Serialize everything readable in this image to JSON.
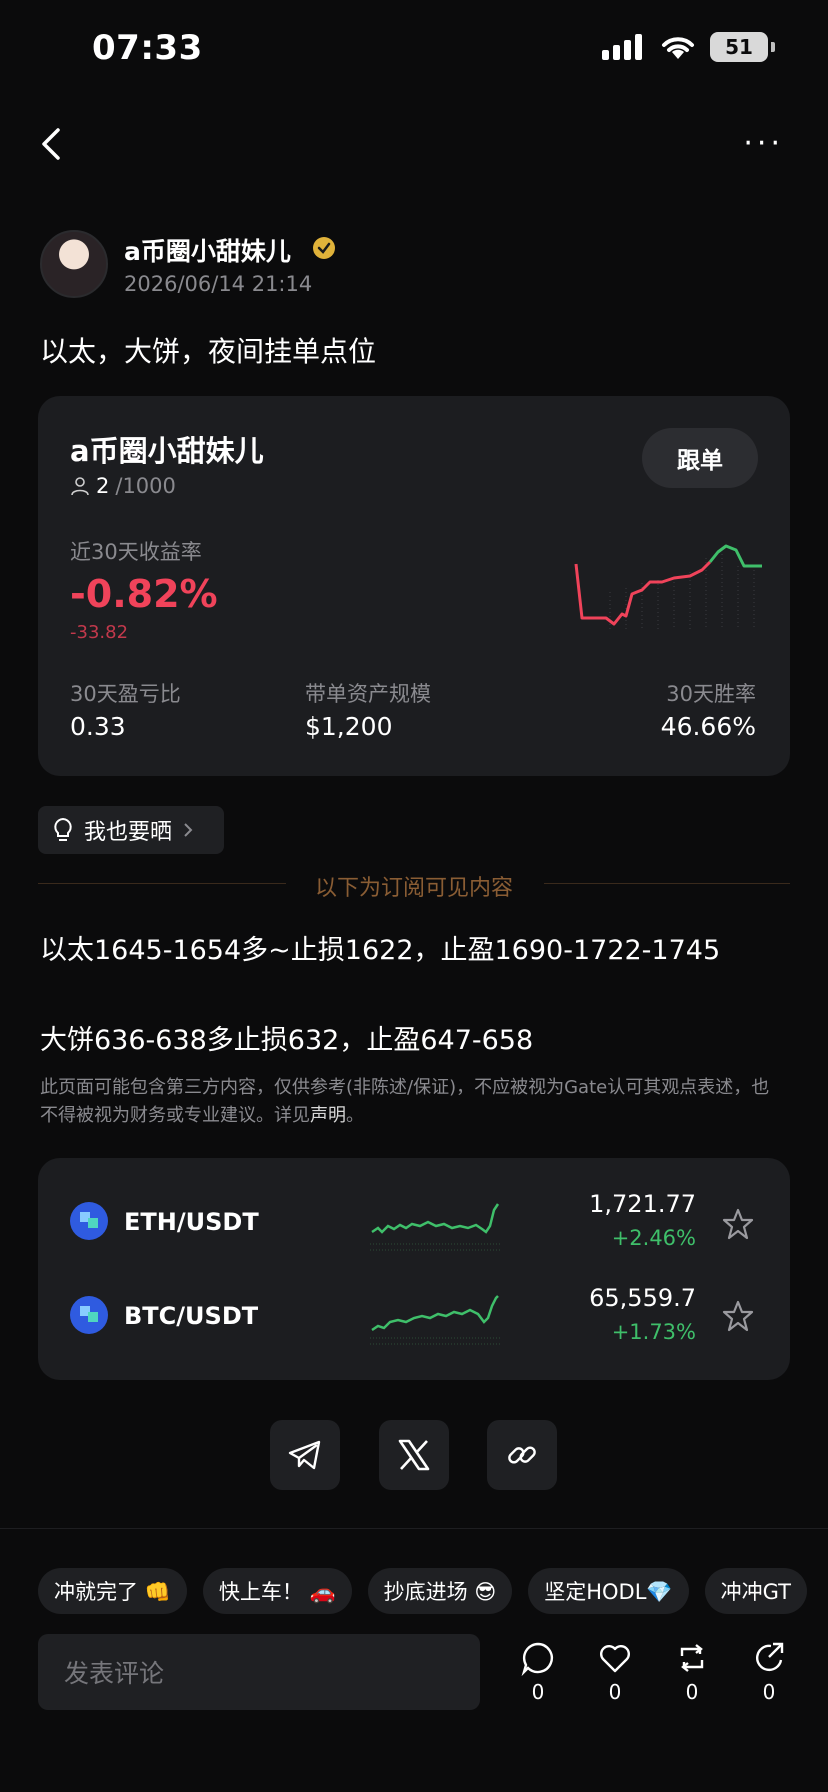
{
  "status_bar": {
    "time": "07:33",
    "battery": "51"
  },
  "post": {
    "author": "a币圈小甜妹儿",
    "time": "2026/06/14 21:14",
    "title": "以太，大饼，夜间挂单点位"
  },
  "trader_card": {
    "name": "a币圈小甜妹儿",
    "followers_current": "2",
    "followers_max": "/1000",
    "follow_label": "跟单",
    "roi_label": "近30天收益率",
    "roi_value": "-0.82%",
    "roi_abs": "-33.82",
    "stats": [
      {
        "label": "30天盈亏比",
        "value": "0.33"
      },
      {
        "label": "带单资产规模",
        "value": "$1,200"
      },
      {
        "label": "30天胜率",
        "value": "46.66%"
      }
    ],
    "colors": {
      "negative": "#f0435a",
      "positive": "#3fbf6a"
    }
  },
  "share_badge": "我也要晒",
  "subscriber_divider": "以下为订阅可见内容",
  "content": [
    "以太1645-1654多~止损1622，止盈1690-1722-1745",
    "大饼636-638多止损632，止盈647-658"
  ],
  "disclaimer": {
    "text": "此页面可能包含第三方内容，仅供参考(非陈述/保证)，不应被视为Gate认可其观点表述，也不得被视为财务或专业建议。详见",
    "link": "声明",
    "end": "。"
  },
  "markets": [
    {
      "pair": "ETH/USDT",
      "price": "1,721.77",
      "change": "+2.46%"
    },
    {
      "pair": "BTC/USDT",
      "price": "65,559.7",
      "change": "+1.73%"
    }
  ],
  "share_buttons": [
    "telegram-icon",
    "x-icon",
    "link-icon"
  ],
  "chips": [
    "冲就完了 👊",
    "快上车！ 🚗",
    "抄底进场 😎",
    "坚定HODL💎",
    "冲冲GT"
  ],
  "comment": {
    "placeholder": "发表评论",
    "actions": [
      {
        "icon": "comment-icon",
        "count": "0"
      },
      {
        "icon": "like-icon",
        "count": "0"
      },
      {
        "icon": "repost-icon",
        "count": "0"
      },
      {
        "icon": "share-icon",
        "count": "0"
      }
    ]
  }
}
